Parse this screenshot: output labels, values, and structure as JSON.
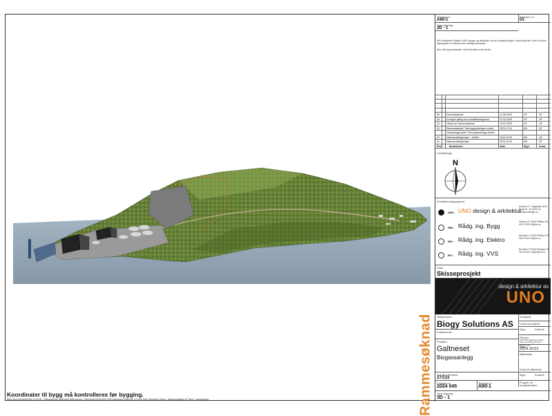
{
  "coordinate_note": "Koordinater til bygg må kontrolleres før bygging.",
  "file_path": "BIM-mod fra ArchiCAD 21 NOR · Filplassering: BIM-bolli: BIM-server - BIM-bolli 2024/2024 045 Galtneset Vidsa AS 27/133/ 045 Galtneset Vidsa - Sammenstilling M Tomt + gassanlegg",
  "stamp_text": "Rammesøknad",
  "title_block": {
    "drawing_no_label": "Tegning nr.:",
    "drawing_no": "A90-1",
    "revision_label": "Revisjon nr.:",
    "revision": "03",
    "type_label": "Type tegning:",
    "type": "3D - 1",
    "rights_text": "Alle rettigheter tilhører UNO design og arkitektur as for prosjekteringen, kopiering eller bruk av disse tegningene er forbudt uten skriftlig samtykke.",
    "measure_text": "Alle mål og koordinater må kontrolleres på stedet.",
    "revisions": [
      {
        "nr": "06",
        "desc": "Rammesøknad",
        "date": "12.06.2025",
        "sign": "UF",
        "ktr": "UF"
      },
      {
        "nr": "05",
        "desc": "Korrigert fylling mot kontaktsylangsmur",
        "date": "07.03.2025",
        "sign": "UF",
        "ktr": "UF"
      },
      {
        "nr": "04",
        "desc": "Utkast for Rammesøknad",
        "date": "15.02.2025",
        "sign": "UF",
        "ktr": "UF"
      },
      {
        "nr": "03",
        "desc": "Rammesøknad. Terrengoppføringer endret.",
        "date": "2024.12.16",
        "sign": "AN",
        "ktr": "UF"
      },
      {
        "nr": "",
        "desc": "Gassanlegg flyttet. Tomt gassanlegg utvidet.",
        "date": "",
        "sign": "",
        "ktr": ""
      },
      {
        "nr": "02",
        "desc": "Nabovarseltegninger - Justert",
        "date": "2024.12.05",
        "sign": "AN",
        "ktr": "UF"
      },
      {
        "nr": "01",
        "desc": "Nabovarseltegninger",
        "date": "2024.12.03",
        "sign": "AN",
        "ktr": "UF"
      }
    ],
    "rev_headers": {
      "nr": "Rev.",
      "ntr": "Nr.",
      "desc": "Beskrivelse",
      "date": "Dato",
      "sign": "Sign.",
      "ktr": "Kontr."
    },
    "location_label": "Lokalisering:",
    "north": "N",
    "team_label": "Prosjekteringsgruppen:",
    "team": [
      {
        "role": "ARK :",
        "firm_brand": "UNO",
        "firm_rest": " design & arkitektur",
        "addr": "Notveien 17, Ålegården 8013 Bodø Tlf.: 91 69 63 44 uno@unodesign.no",
        "filled": true
      },
      {
        "role": "RIB :",
        "firm_brand": "",
        "firm_rest": "Rådg. ing. Bygg",
        "addr": "PMveien 27 8000 PMByen Tlf: 000 00 000 rib@rib.no",
        "filled": false
      },
      {
        "role": "RIE :",
        "firm_brand": "",
        "firm_rest": "Rådg. ing. Elektro",
        "addr": "RIEveien 27 8000 RIEByen Tlf: 000 00 000 rie@rie.no",
        "filled": false
      },
      {
        "role": "RIV :",
        "firm_brand": "",
        "firm_rest": "Rådg. ing. VVS",
        "addr": "RIVveien 27 8000 RIVByen Tlf: 000 00 000 riv@rivfirma.no",
        "filled": false
      }
    ],
    "phase_label": "Fase:",
    "phase": "Skisseprosjekt",
    "logo_text": "design & arkitektur as",
    "logo_uno": "UNO",
    "client_label": "Tiltakshaver:",
    "client": "Biogy Solutions AS",
    "approved_label": "Godkjent:",
    "control_label": "Kontroll prosjekt:",
    "sign_label": "Sign.:",
    "kontroll_label": "Kontroll",
    "contractor_label": "Entreprenør:",
    "filename_label": "Filnavn:",
    "filename": "2024 045 Galtneset Vidsa - Sammenstilling M Tomt + gassanlegg",
    "date_label": "Dato:",
    "date": "2024.10.01",
    "scale_label": "Målestokk:",
    "project_label": "Prosjekt:",
    "project": "Galtneset",
    "project_sub": "Biogassanlegg",
    "control_exec_label": "Kontroll utførende",
    "gnr_label": "Gnr./Bnr./Festenr.:",
    "gnr": "27/133",
    "project_no_label": "Prosjekt nr.:",
    "project_no": "2024 045",
    "drawing_no2_label": "Tegning nr.:",
    "drawing_no2": "A90-1",
    "project_sign_label": "Prosjekt. for prosjektendelse:",
    "type2_label": "Type tegning:",
    "type2": "3D - 1"
  },
  "colors": {
    "stamp": "#e48a2e",
    "brand": "#e07d1f",
    "sea": "#8fa3b3",
    "land": "#6f8a3c"
  }
}
